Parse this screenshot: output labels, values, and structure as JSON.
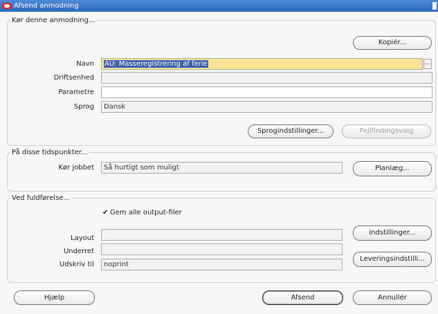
{
  "window": {
    "title": "Afsend anmodning"
  },
  "run_request": {
    "legend": "Kør denne anmodning...",
    "copy_button": "Kopiér...",
    "name_label": "Navn",
    "name_value": "AU: Masseregistrering af ferie",
    "lov_button": "...",
    "operating_unit_label": "Driftsenhed",
    "operating_unit_value": "",
    "parameters_label": "Parametre",
    "parameters_value": "",
    "language_label": "Sprog",
    "language_value": "Dansk",
    "language_settings_button": "Sprogindstillinger...",
    "debug_options_button": "Fejlfindingsvalg"
  },
  "schedule": {
    "legend": "På disse tidspunkter...",
    "run_job_label": "Kør jobbet",
    "run_job_value": "Så hurtigt som muligt",
    "schedule_button": "Planlæg..."
  },
  "completion": {
    "legend": "Ved fuldførelse...",
    "save_outputs_checked": true,
    "save_outputs_label": "Gem alle output-filer",
    "layout_label": "Layout",
    "layout_value": "",
    "notify_label": "Underret",
    "notify_value": "",
    "print_to_label": "Udskriv til",
    "print_to_value": "noprint",
    "options_button": "Indstillinger...",
    "delivery_button": "Leveringsindstilli..."
  },
  "footer": {
    "help_button": "Hjælp",
    "submit_button": "Afsend",
    "cancel_button": "Annullér"
  },
  "colors": {
    "titlebar": "#2d69bd",
    "required_field": "#fbe493",
    "selection": "#3b5fa8"
  }
}
